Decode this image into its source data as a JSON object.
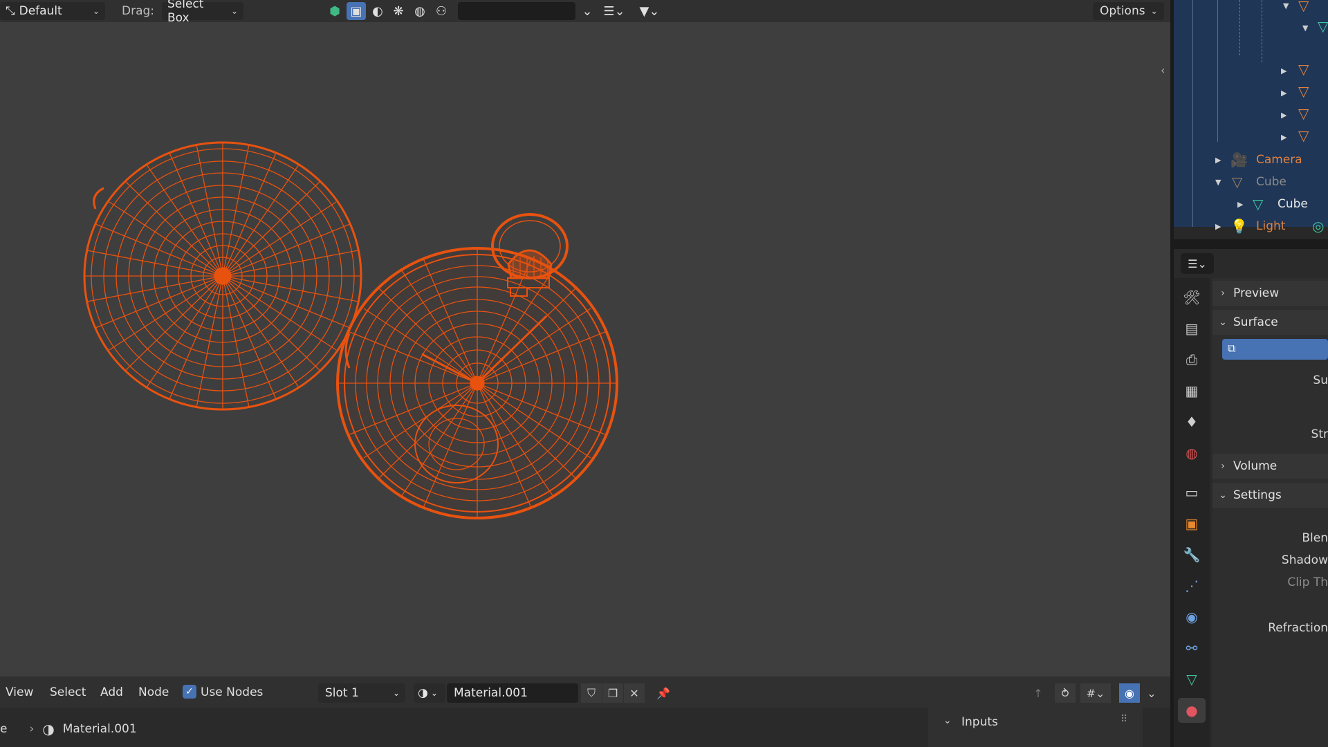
{
  "top_header": {
    "workspace": "Default",
    "drag_label": "Drag:",
    "drag_mode": "Select Box",
    "options_label": "Options"
  },
  "outliner": {
    "rows": [
      {
        "name": "Camera",
        "type": "camera",
        "color": "#e0813f"
      },
      {
        "name": "Cube",
        "type": "mesh-object",
        "color": "#8a8a8a"
      },
      {
        "name": "Cube",
        "type": "mesh-data",
        "color": "#e6e6e6"
      },
      {
        "name": "Light",
        "type": "light",
        "color": "#e0813f"
      }
    ]
  },
  "properties": {
    "sections": {
      "preview": "Preview",
      "surface": "Surface",
      "volume": "Volume",
      "settings": "Settings"
    },
    "labels": {
      "surface_prop": "Su",
      "strength_prop": "Str",
      "blend": "Blen",
      "shadow": "Shadow",
      "clip": "Clip Th",
      "refraction": "Refraction"
    }
  },
  "node_header": {
    "menus": [
      "View",
      "Select",
      "Add",
      "Node"
    ],
    "use_nodes_label": "Use Nodes",
    "use_nodes_checked": true,
    "slot": "Slot 1",
    "material_name": "Material.001"
  },
  "bottom": {
    "breadcrumb_prefix": "e",
    "breadcrumb_material": "Material.001",
    "inputs_label": "Inputs"
  },
  "colors": {
    "accent": "#4772b3",
    "wire": "#e8520f",
    "selection": "#1f3657"
  }
}
